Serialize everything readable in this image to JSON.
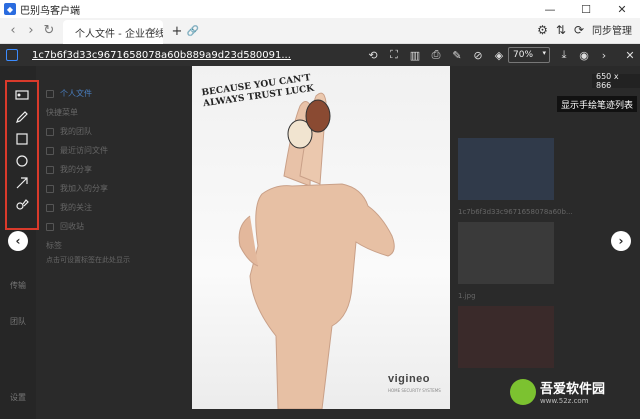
{
  "window": {
    "title": "巴别鸟客户端",
    "min_glyph": "—",
    "max_glyph": "☐",
    "close_glyph": "✕"
  },
  "nav": {
    "back_glyph": "‹",
    "forward_glyph": "›",
    "refresh_glyph": "↻",
    "tab_label": "个人文件 - 企业在线…",
    "tab_close": "×",
    "new_tab": "+",
    "link_icon": "🔗",
    "settings_glyph": "⚙",
    "transfer_glyph": "⇅",
    "sync_label": "同步管理"
  },
  "viewer": {
    "filename": "1c7b6f3d33c9671658078a60b889a9d23d580091...",
    "zoom_value": "70%",
    "zoom_arrow": "▾",
    "dimension_badge": "650 x 866",
    "tooltip": "显示手绘笔迹列表",
    "prev_glyph": "‹",
    "next_glyph": "›",
    "next_top_glyph": "›",
    "close_glyph": "✕",
    "tool_glyphs": [
      "⟲",
      "⛶",
      "▥",
      "⎙",
      "✎",
      "⊘",
      "◈"
    ],
    "tool2_glyphs": [
      "⤓",
      "◉"
    ]
  },
  "photo": {
    "headline": "BECAUSE YOU CAN'T ALWAYS TRUST LUCK",
    "brand": "vigineo",
    "tagline": "HOME SECURITY SYSTEMS"
  },
  "background": {
    "nav_items": [
      "个人文件",
      "快捷菜单",
      "我的团队",
      "最近访问文件",
      "我的分享",
      "我加入的分享",
      "我的关注",
      "回收站",
      "标签",
      "点击可设置标签在此处显示"
    ],
    "side_items": [
      "传输",
      "团队",
      "设置"
    ],
    "thumb_caption_1": "1c7b6f3d33c9671658078a60b...",
    "thumb_caption_2": "1.jpg"
  },
  "watermark": {
    "text": "吾爱软件园",
    "sub": "www.52z.com"
  },
  "colors": {
    "annotation_border": "#d93a2b",
    "filename": "#ffffff",
    "viewer_bar": "#2f2f2f"
  }
}
